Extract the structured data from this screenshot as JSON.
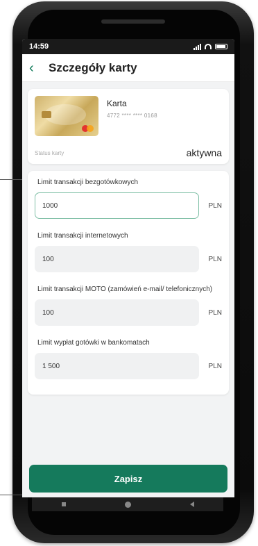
{
  "statusbar": {
    "time": "14:59"
  },
  "header": {
    "title": "Szczegóły karty",
    "back_icon": "chevron-left-icon"
  },
  "card": {
    "name": "Karta",
    "number": "4772 **** **** 0168",
    "status_label": "Status karty",
    "status_value": "aktywna"
  },
  "limits": [
    {
      "label": "Limit transakcji bezgotówkowych",
      "value": "1000",
      "currency": "PLN",
      "focused": true
    },
    {
      "label": "Limit transakcji internetowych",
      "value": "100",
      "currency": "PLN",
      "focused": false
    },
    {
      "label": "Limit transakcji MOTO (zamówień e-mail/ telefonicznych)",
      "value": "100",
      "currency": "PLN",
      "focused": false
    },
    {
      "label": "Limit wypłat gotówki w bankomatach",
      "value": "1 500",
      "currency": "PLN",
      "focused": false
    }
  ],
  "save_button": {
    "label": "Zapisz"
  },
  "colors": {
    "accent": "#157a5c",
    "background": "#f2f3f4"
  }
}
